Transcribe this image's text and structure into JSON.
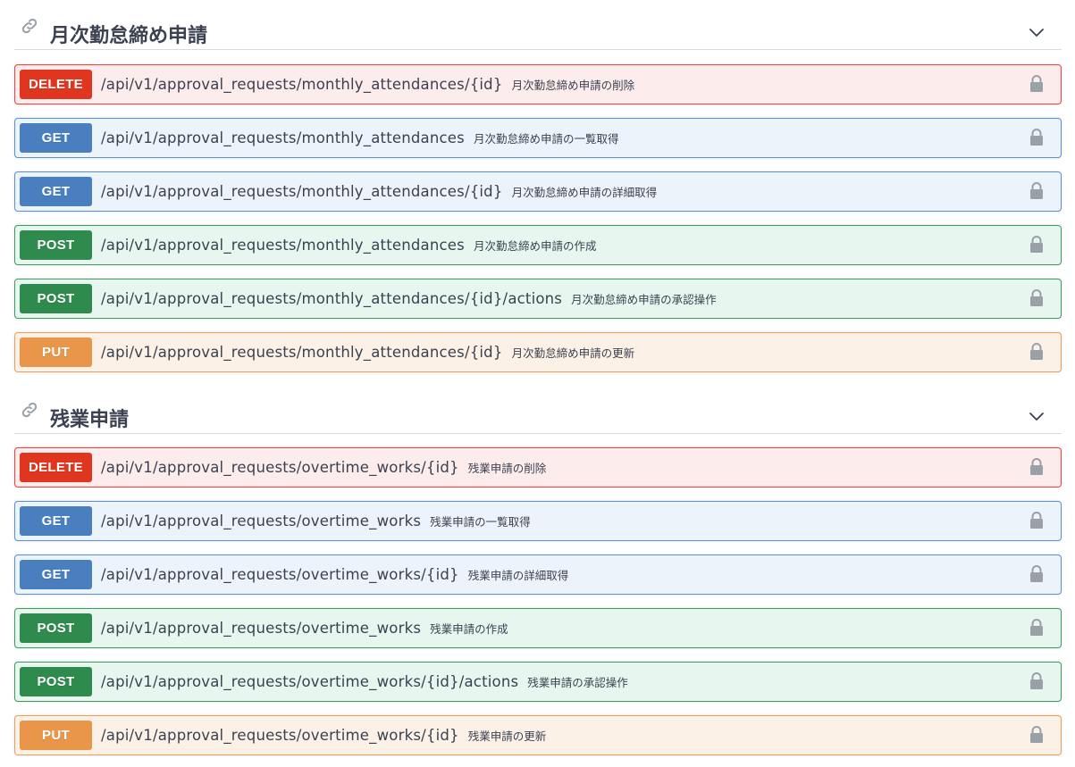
{
  "sections": [
    {
      "title": "月次勤怠締め申請",
      "operations": [
        {
          "method": "DELETE",
          "path": "/api/v1/approval_requests/monthly_attendances/{id}",
          "summary": "月次勤怠締め申請の削除"
        },
        {
          "method": "GET",
          "path": "/api/v1/approval_requests/monthly_attendances",
          "summary": "月次勤怠締め申請の一覧取得"
        },
        {
          "method": "GET",
          "path": "/api/v1/approval_requests/monthly_attendances/{id}",
          "summary": "月次勤怠締め申請の詳細取得"
        },
        {
          "method": "POST",
          "path": "/api/v1/approval_requests/monthly_attendances",
          "summary": "月次勤怠締め申請の作成"
        },
        {
          "method": "POST",
          "path": "/api/v1/approval_requests/monthly_attendances/{id}/actions",
          "summary": "月次勤怠締め申請の承認操作"
        },
        {
          "method": "PUT",
          "path": "/api/v1/approval_requests/monthly_attendances/{id}",
          "summary": "月次勤怠締め申請の更新"
        }
      ]
    },
    {
      "title": "残業申請",
      "operations": [
        {
          "method": "DELETE",
          "path": "/api/v1/approval_requests/overtime_works/{id}",
          "summary": "残業申請の削除"
        },
        {
          "method": "GET",
          "path": "/api/v1/approval_requests/overtime_works",
          "summary": "残業申請の一覧取得"
        },
        {
          "method": "GET",
          "path": "/api/v1/approval_requests/overtime_works/{id}",
          "summary": "残業申請の詳細取得"
        },
        {
          "method": "POST",
          "path": "/api/v1/approval_requests/overtime_works",
          "summary": "残業申請の作成"
        },
        {
          "method": "POST",
          "path": "/api/v1/approval_requests/overtime_works/{id}/actions",
          "summary": "残業申請の承認操作"
        },
        {
          "method": "PUT",
          "path": "/api/v1/approval_requests/overtime_works/{id}",
          "summary": "残業申請の更新"
        }
      ]
    }
  ],
  "colors": {
    "delete": "#e0361f",
    "get": "#4a7fbf",
    "post": "#2f8a4d",
    "put": "#e9954a"
  },
  "icons": {
    "section_link": "link-icon",
    "section_toggle": "chevron-down-icon",
    "operation_auth": "lock-icon"
  }
}
